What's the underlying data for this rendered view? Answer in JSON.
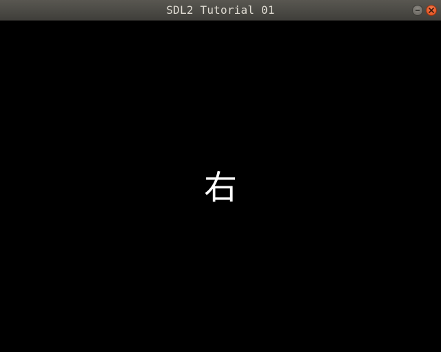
{
  "window": {
    "title": "SDL2 Tutorial 01"
  },
  "controls": {
    "minimize_icon": "minimize-icon",
    "close_icon": "close-icon",
    "close_color": "#e55b2a"
  },
  "canvas": {
    "background": "#000000",
    "text": "右",
    "text_color": "#ffffff"
  }
}
